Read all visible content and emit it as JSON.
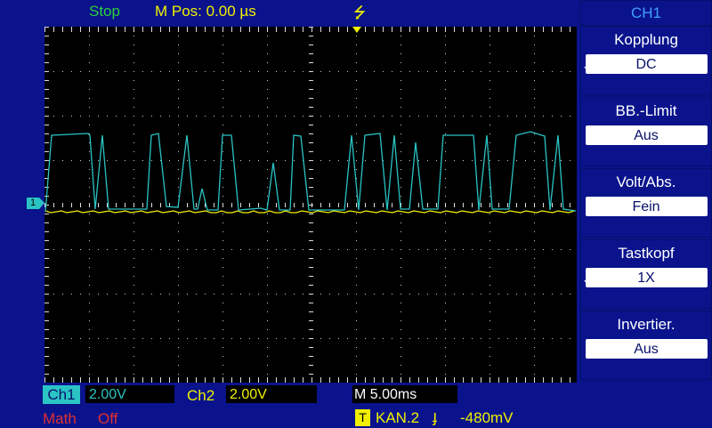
{
  "status": "Stop",
  "mpos": "M Pos: 0.00 µs",
  "usb_icon": "usb-icon",
  "menu": {
    "header": "CH1",
    "items": [
      {
        "label": "Kopplung",
        "value": "DC",
        "arrow": true
      },
      {
        "label": "BB.-Limit",
        "value": "Aus",
        "arrow": false
      },
      {
        "label": "Volt/Abs.",
        "value": "Fein",
        "arrow": false
      },
      {
        "label": "Tastkopf",
        "value": "1X",
        "arrow": true
      },
      {
        "label": "Invertier.",
        "value": "Aus",
        "arrow": false
      }
    ]
  },
  "bottom": {
    "ch1_label": "Ch1",
    "ch1_scale": "2.00V",
    "ch2_label": "Ch2",
    "ch2_scale": "2.00V",
    "time_scale": "M 5.00ms",
    "math": "Math",
    "math_state": "Off",
    "trigger_badge": "T",
    "trigger_source": "KAN.2",
    "trigger_edge_icon": "rising-edge-icon",
    "trigger_level": "-480mV"
  },
  "ch1_marker": "1",
  "colors": {
    "ch1": "#2bc4c4",
    "ch2": "#f0f000",
    "bg": "#0a138c"
  }
}
